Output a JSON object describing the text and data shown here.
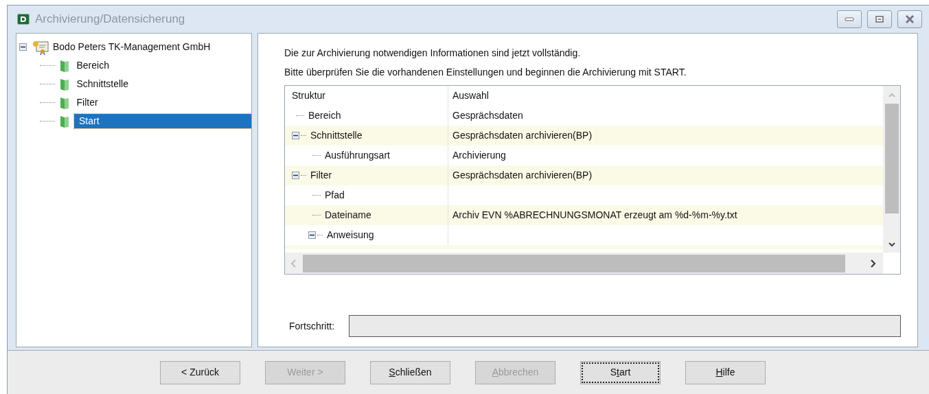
{
  "window": {
    "title": "Archivierung/Datensicherung"
  },
  "steps_tree": {
    "label": "Bodo Peters TK-Management GmbH",
    "expanded": true,
    "children": [
      {
        "label": "Bereich",
        "selected": false
      },
      {
        "label": "Schnittstelle",
        "selected": false
      },
      {
        "label": "Filter",
        "selected": false
      },
      {
        "label": "Start",
        "selected": true
      }
    ]
  },
  "intro": [
    "Die zur Archivierung notwendigen Informationen sind jetzt vollständig.",
    "Bitte überprüfen Sie die vorhandenen Einstellungen und beginnen die Archivierung mit START."
  ],
  "grid": {
    "columns": [
      "Struktur",
      "Auswahl"
    ],
    "rows": [
      {
        "label": "Bereich",
        "value": "Gesprächsdaten"
      },
      {
        "label": "Schnittstelle",
        "value": "Gesprächsdaten archivieren(BP)",
        "expanded": true,
        "children": [
          {
            "label": "Ausführungsart",
            "value": "Archivierung"
          }
        ]
      },
      {
        "label": "Filter",
        "value": "Gesprächsdaten archivieren(BP)",
        "expanded": true,
        "children": [
          {
            "label": "Pfad"
          },
          {
            "label": "Dateiname",
            "value": "Archiv EVN %ABRECHNUNGSMONAT erzeugt am %d-%m-%y.txt"
          },
          {
            "label": "Anweisung",
            "expanded": true
          }
        ]
      }
    ]
  },
  "progress": {
    "label": "Fortschritt:",
    "level": 0
  },
  "buttons": [
    {
      "before": "< Zurück",
      "disabled": false,
      "focused": false
    },
    {
      "before": "Weiter >",
      "disabled": true,
      "focused": false
    },
    {
      "key": "S",
      "after": "chließen",
      "disabled": false,
      "focused": false
    },
    {
      "key": "A",
      "after": "bbrechen",
      "disabled": true,
      "focused": false
    },
    {
      "before": "S",
      "key": "t",
      "after": "art",
      "disabled": false,
      "focused": true
    },
    {
      "key": "H",
      "after": "ilfe",
      "disabled": false,
      "focused": false
    }
  ]
}
